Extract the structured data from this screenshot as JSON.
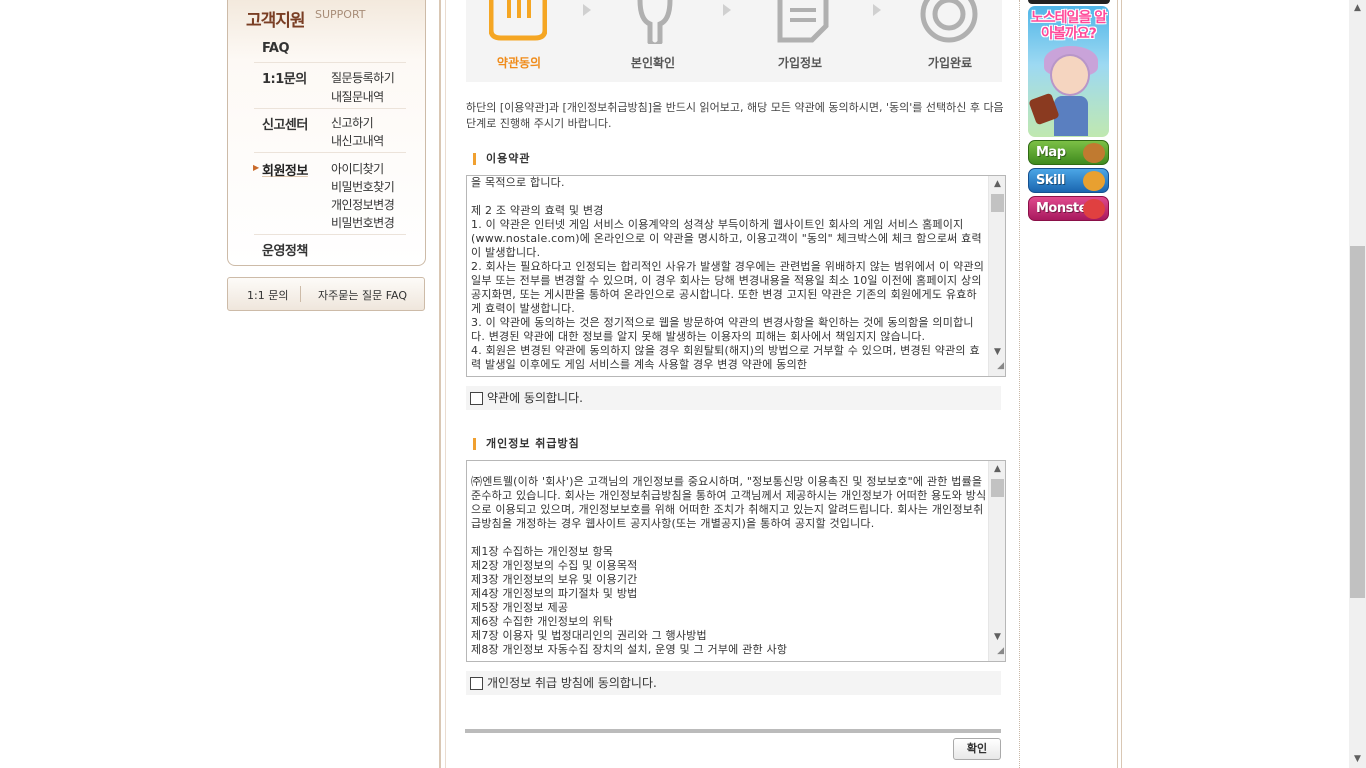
{
  "sidebar": {
    "title": "고객지원",
    "subtitle": "SUPPORT",
    "menu": {
      "faq": "FAQ",
      "inquiry": "1:1문의",
      "inquiry_sub1": "질문등록하기",
      "inquiry_sub2": "내질문내역",
      "report": "신고센터",
      "report_sub1": "신고하기",
      "report_sub2": "내신고내역",
      "member": "회원정보",
      "member_sub1": "아이디찾기",
      "member_sub2": "비밀번호찾기",
      "member_sub3": "개인정보변경",
      "member_sub4": "비밀번호변경",
      "policy": "운영정책"
    },
    "quick": {
      "inquiry": "1:1 문의",
      "faq": "자주묻는 질문 FAQ"
    }
  },
  "steps": {
    "step1": "약관동의",
    "step2": "본인확인",
    "step3": "가입정보",
    "step4": "가입완료",
    "active_color": "#f08c1a"
  },
  "intro": "하단의 [이용약관]과 [개인정보취급방침]을 반드시 읽어보고, 해당 모든 약관에 동의하시면, '동의'를 선택하신 후 다음 단계로 진행해 주시기 바랍니다.",
  "terms": {
    "title": "이용약관",
    "text": "을 목적으로 합니다.\n\n제 2 조 약관의 효력 및 변경\n1. 이 약관은 인터넷 게임 서비스 이용계약의 성격상 부득이하게 웹사이트인 회사의 게임 서비스 홈페이지(www.nostale.com)에 온라인으로 이 약관을 명시하고, 이용고객이 \"동의\" 체크박스에 체크 함으로써 효력이 발생합니다.\n2. 회사는 필요하다고 인정되는 합리적인 사유가 발생할 경우에는 관련법을 위배하지 않는 범위에서 이 약관의 일부 또는 전부를 변경할 수 있으며, 이 경우 회사는 당해 변경내용을 적용일 최소 10일 이전에 홈페이지 상의 공지화면, 또는 게시판을 통하여 온라인으로 공시합니다. 또한 변경 고지된 약관은 기존의 회원에게도 유효하게 효력이 발생합니다.\n3. 이 약관에 동의하는 것은 정기적으로 웹을 방문하여 약관의 변경사항을 확인하는 것에 동의함을 의미합니다. 변경된 약관에 대한 정보를 알지 못해 발생하는 이용자의 피해는 회사에서 책임지지 않습니다.\n4. 회원은 변경된 약관에 동의하지 않을 경우 회원탈퇴(해지)의 방법으로 거부할 수 있으며, 변경된 약관의 효력 발생일 이후에도 게임 서비스를 계속 사용할 경우 변경 약관에 동의한",
    "agree_label": "약관에 동의합니다."
  },
  "privacy": {
    "title": "개인정보 취급방침",
    "text": "\n㈜엔트웰(이하 '회사')은 고객님의 개인정보를 중요시하며, \"정보통신망 이용촉진 및 정보보호\"에 관한 법률을 준수하고 있습니다. 회사는 개인정보취급방침을 통하여 고객님께서 제공하시는 개인정보가 어떠한 용도와 방식으로 이용되고 있으며, 개인정보보호를 위해 어떠한 조치가 취해지고 있는지 알려드립니다. 회사는 개인정보취급방침을 개정하는 경우 웹사이트 공지사항(또는 개별공지)을 통하여 공지할 것입니다.\n\n제1장 수집하는 개인정보 항목\n제2장 개인정보의 수집 및 이용목적\n제3장 개인정보의 보유 및 이용기간\n제4장 개인정보의 파기절차 및 방법\n제5장 개인정보 제공\n제6장 수집한 개인정보의 위탁\n제7장 이용자 및 법정대리인의 권리와 그 행사방법\n제8장 개인정보 자동수집 장치의 설치, 운영 및 그 거부에 관한 사항",
    "agree_label": "개인정보 취급 방침에 동의합니다."
  },
  "confirm_label": "확인",
  "banners": {
    "main_text": "노스테일을 알아볼까요?",
    "map": "Map",
    "skill": "Skill",
    "monster": "Monster"
  }
}
